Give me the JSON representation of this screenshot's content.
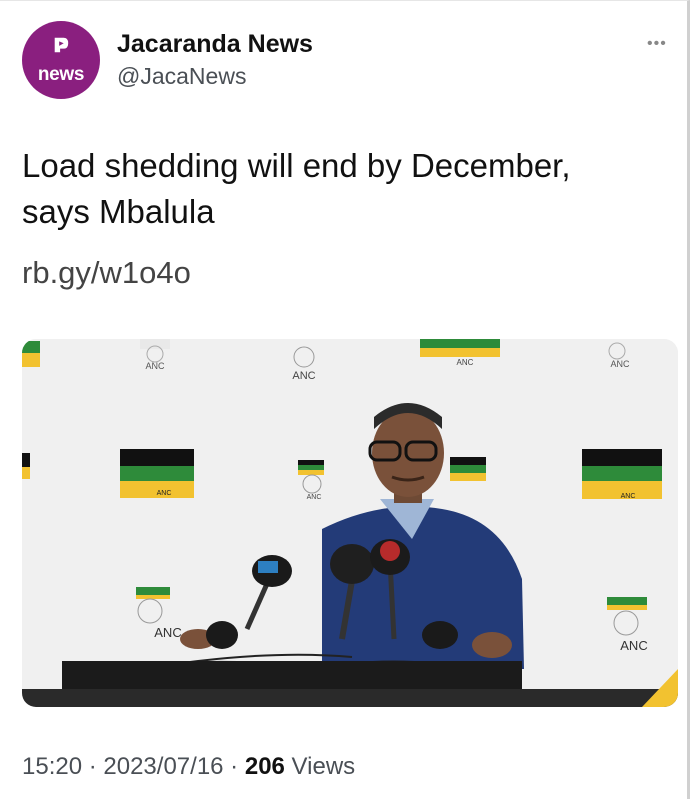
{
  "account": {
    "avatar_text": "news",
    "name": "Jacaranda News",
    "handle": "@JacaNews"
  },
  "tweet": {
    "text_line1": "Load shedding will end by December,",
    "text_line2": "says Mbalula",
    "link": "rb.gy/w1o4o"
  },
  "photo": {
    "backdrop_logo_label": "ANC",
    "flag_colors": [
      "#111111",
      "#2e8b3a",
      "#f2c230"
    ]
  },
  "meta": {
    "time": "15:20",
    "separator": " · ",
    "date": "2023/07/16",
    "views_count": "206",
    "views_label": " Views"
  },
  "icons": {
    "more": "more-horizontal-icon",
    "avatar_logo": "jacaranda-logo-icon"
  },
  "colors": {
    "avatar_bg": "#8a1f7f",
    "text": "#111111",
    "secondary": "#4a4f55"
  }
}
